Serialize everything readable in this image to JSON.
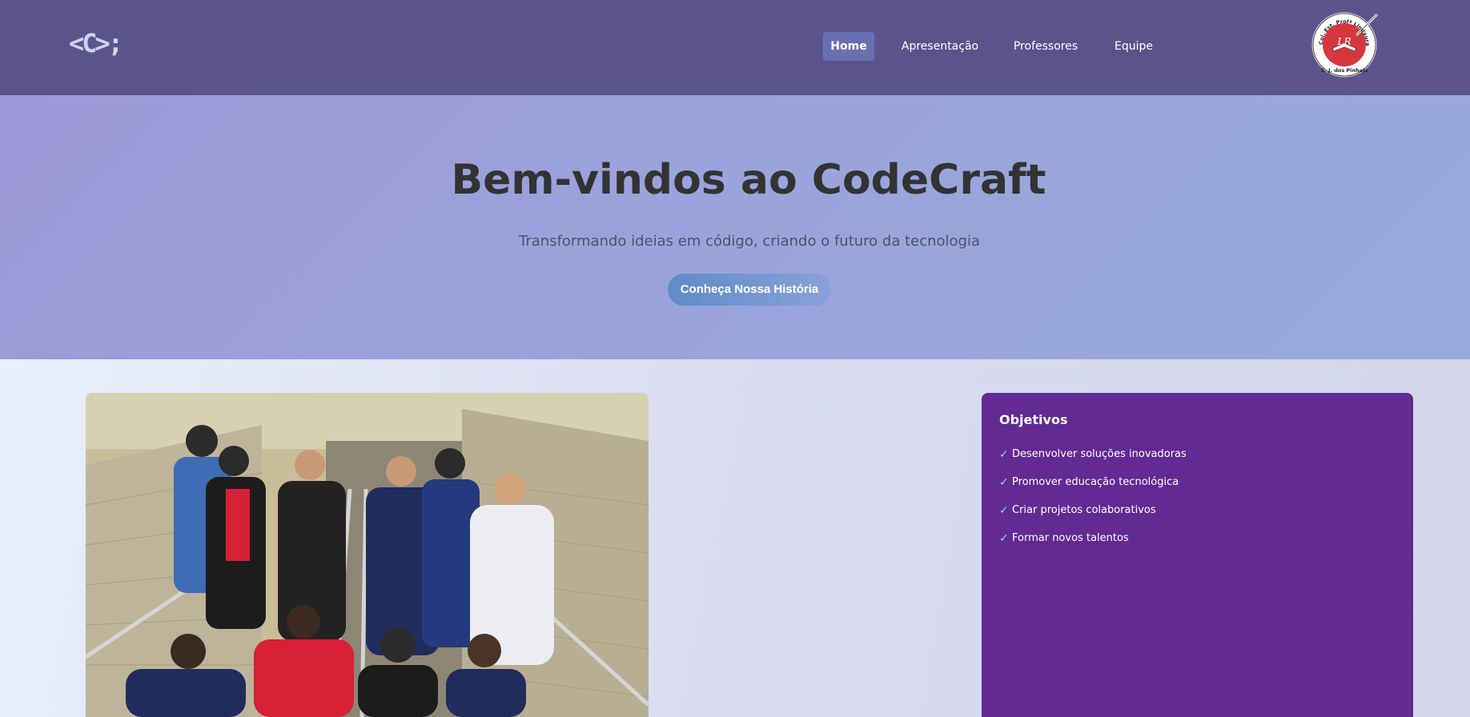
{
  "header": {
    "logo_text": "<C>;",
    "nav": [
      {
        "label": "Home",
        "active": true
      },
      {
        "label": "Apresentação",
        "active": false
      },
      {
        "label": "Professores",
        "active": false
      },
      {
        "label": "Equipe",
        "active": false
      }
    ],
    "seal": {
      "ring_text": "Col. Est. Profª Lindaura Ribeiro Lucas",
      "bottom_text": "S. J. dos Pinhais",
      "monogram": "LR"
    }
  },
  "hero": {
    "title": "Bem-vindos ao CodeCraft",
    "subtitle": "Transformando ideias em código, criando o futuro da tecnologia",
    "cta_label": "Conheça Nossa História"
  },
  "objectives": {
    "title": "Objetivos",
    "items": [
      "Desenvolver soluções inovadoras",
      "Promover educação tecnológica",
      "Criar projetos colaborativos",
      "Formar novos talentos"
    ],
    "check_icon": "✓"
  },
  "colors": {
    "header_bg": "#5b548c",
    "nav_active_bg": "#6a6fb0",
    "card_bg": "#622a92",
    "check": "#8fd1ff"
  }
}
